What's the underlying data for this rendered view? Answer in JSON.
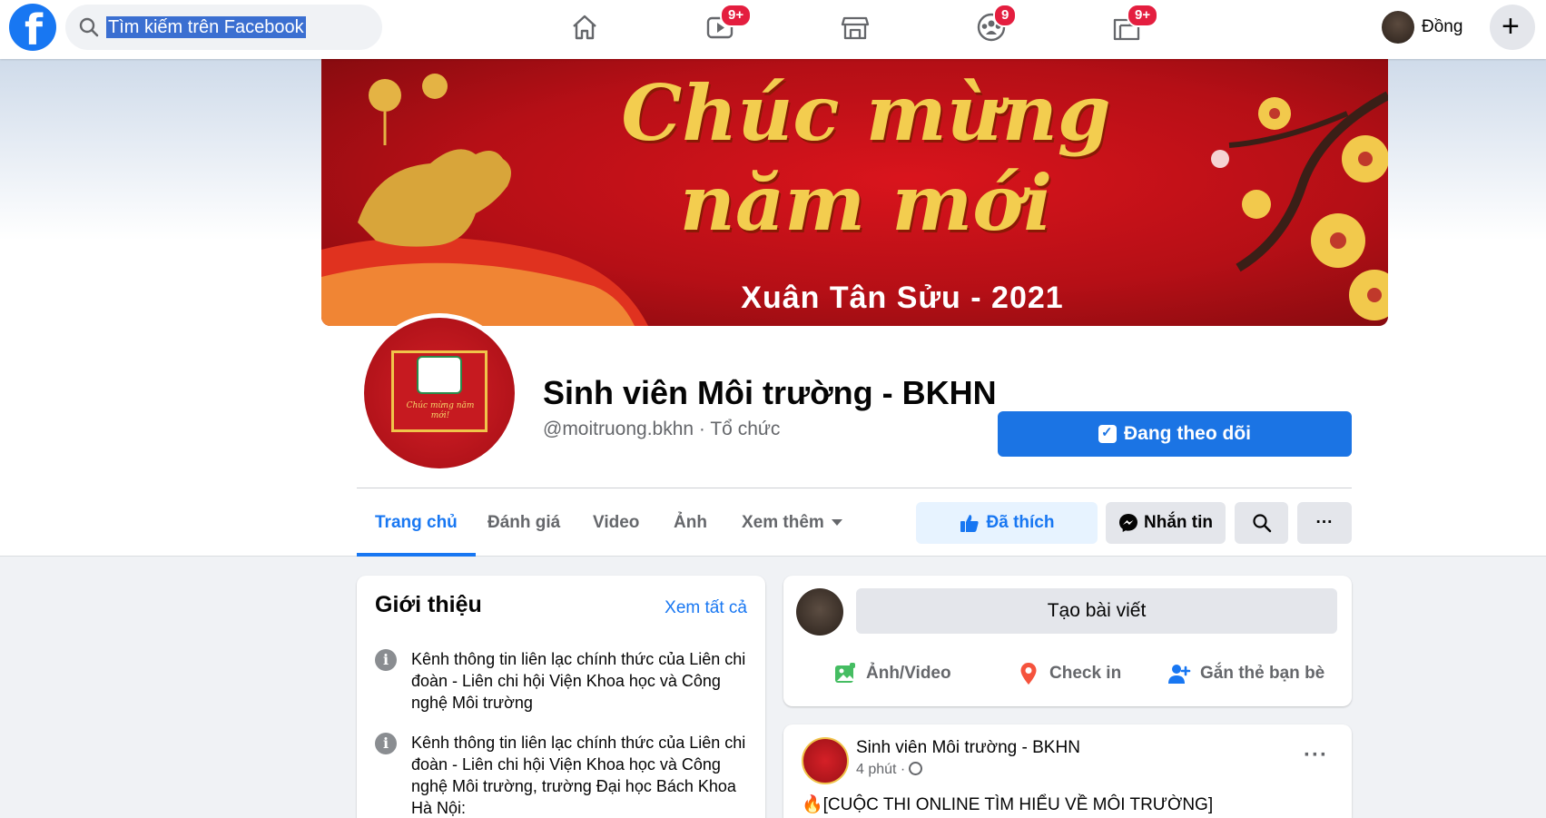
{
  "topbar": {
    "logo_letter": "f",
    "search_text": "Tìm kiếm trên Facebook",
    "nav": [
      {
        "name": "home",
        "badge": ""
      },
      {
        "name": "watch",
        "badge": "9+"
      },
      {
        "name": "marketplace",
        "badge": ""
      },
      {
        "name": "groups",
        "badge": "9"
      },
      {
        "name": "gaming",
        "badge": "9+"
      }
    ],
    "profile_name": "Đồng",
    "plus": "+"
  },
  "cover": {
    "title": "Chúc mừng năm mới",
    "subtitle": "Xuân Tân Sửu - 2021"
  },
  "page": {
    "name": "Sinh viên Môi trường - BKHN",
    "handle": "@moitruong.bkhn · Tổ chức",
    "follow_label": "Đang theo dõi",
    "avatar_text": "Chúc mừng năm mới!"
  },
  "tabs": [
    {
      "label": "Trang chủ",
      "active": true
    },
    {
      "label": "Đánh giá",
      "active": false
    },
    {
      "label": "Video",
      "active": false
    },
    {
      "label": "Ảnh",
      "active": false
    },
    {
      "label": "Xem thêm",
      "active": false
    }
  ],
  "actions": {
    "liked_label": "Đã thích",
    "message_label": "Nhắn tin",
    "more_label": "···"
  },
  "intro": {
    "title": "Giới thiệu",
    "see_all": "Xem tất cả",
    "items": [
      {
        "text": "Kênh thông tin liên lạc chính thức của Liên chi đoàn - Liên chi hội Viện Khoa học và Công nghệ Môi trường"
      },
      {
        "text": "Kênh thông tin liên lạc chính thức của Liên chi đoàn - Liên chi hội Viện Khoa học và Công nghệ Môi trường, trường Đại học Bách Khoa Hà Nội:"
      }
    ]
  },
  "composer": {
    "create_label": "Tạo bài viết",
    "options": [
      {
        "label": "Ảnh/Video",
        "color": "#45bd62"
      },
      {
        "label": "Check in",
        "color": "#f5533d"
      },
      {
        "label": "Gắn thẻ bạn bè",
        "color": "#1877f2"
      }
    ]
  },
  "post": {
    "author": "Sinh viên Môi trường - BKHN",
    "time": "4 phút ·",
    "more": "···",
    "text": "🔥[CUỘC THI ONLINE TÌM HIỂU VỀ MÔI TRƯỜNG]"
  },
  "colors": {
    "accent": "#1877f2",
    "badge": "#e41e3f",
    "cover_red": "#c8131b",
    "gold": "#f3cd4f"
  }
}
